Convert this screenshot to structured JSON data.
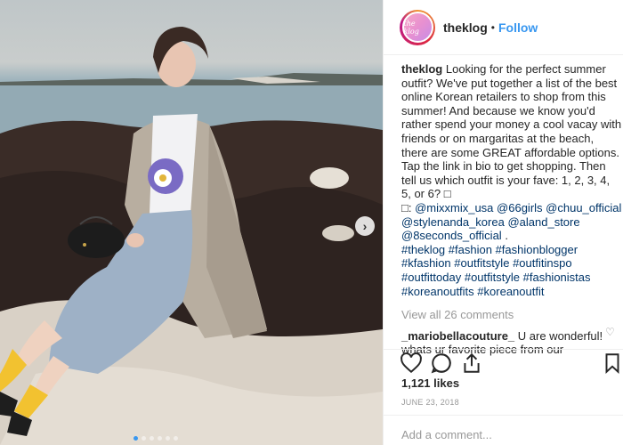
{
  "post": {
    "username": "theklog",
    "follow_label": "Follow",
    "separator": "•",
    "avatar_text": "the klog"
  },
  "caption": {
    "username": "theklog",
    "text_1": "Looking for the perfect summer outfit? We've put together a list of the best online Korean retailers to shop from this summer! And because we know you'd rather spend your money a cool vacay with friends or on margaritas at the beach, there are some GREAT affordable options. Tap the link in bio to get shopping. Then tell us which outfit is your fave: 1, 2, 3, 4, 5, or 6? □",
    "glyph": "□:",
    "mentions": [
      "@mixxmix_usa",
      "@66girls",
      "@chuu_official",
      "@stylenanda_korea",
      "@aland_store",
      "@8seconds_official"
    ],
    "hashtags": [
      "#theklog",
      "#fashion",
      "#fashionblogger",
      "#kfashion",
      "#outfitstyle",
      "#outfitinspo",
      "#outfittoday",
      "#outfitstyle",
      "#fashionistas",
      "#koreanoutfits",
      "#koreanoutfit"
    ]
  },
  "view_all_comments": "View all 26 comments",
  "comment": {
    "username": "_mariobellacouture_",
    "text": "U are wonderful! whats ur favorite piece from our"
  },
  "likes": "1,121 likes",
  "date": "JUNE 23, 2018",
  "add_comment_placeholder": "Add a comment...",
  "carousel": {
    "slides": 6,
    "active_index": 0
  },
  "colors": {
    "accent": "#3897f0",
    "text": "#262626",
    "muted": "#999999",
    "hashtag": "#003569"
  },
  "icons": [
    "heart-icon",
    "comment-icon",
    "share-icon",
    "bookmark-icon",
    "chevron-right-icon"
  ]
}
